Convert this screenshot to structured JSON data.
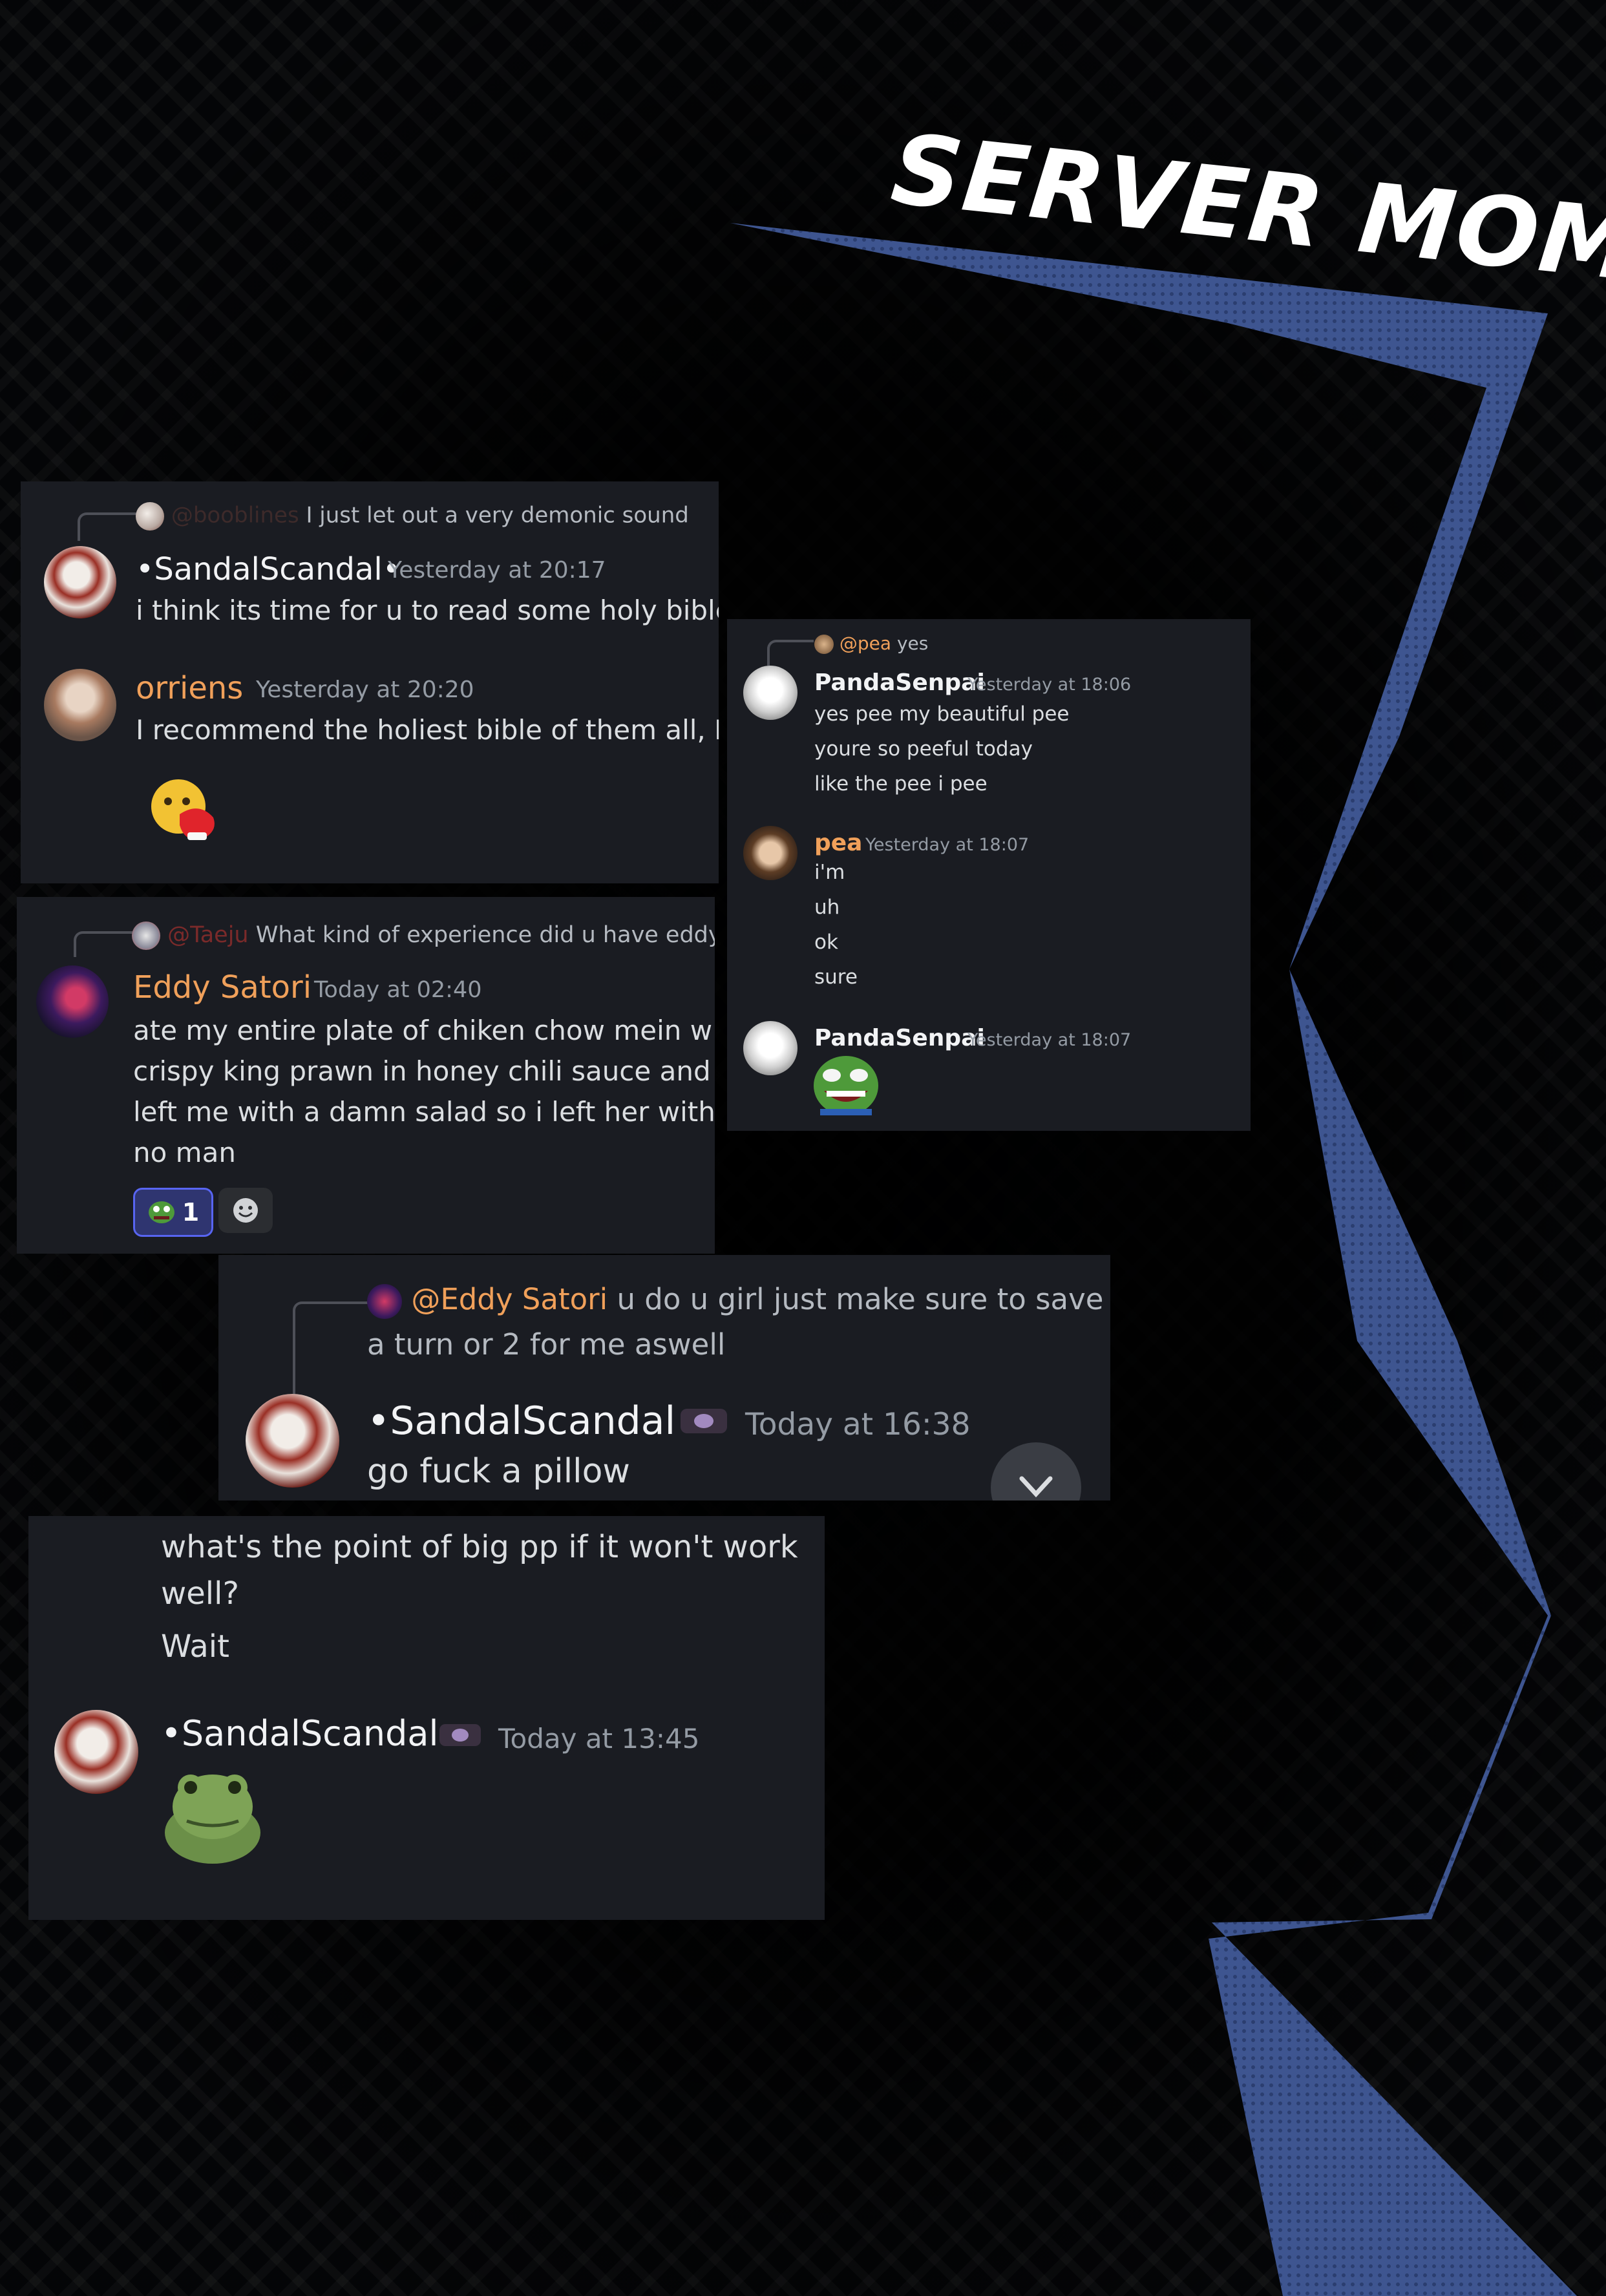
{
  "title": "SERVER MOMENTS",
  "colors": {
    "background": "#050608",
    "panel": "#1a1c22",
    "bolt": "#3e5590",
    "orange_name": "#f0a05a"
  },
  "panel1": {
    "reply": {
      "mention": "@booblines",
      "text": "I just let out a very demonic sound"
    },
    "msg1": {
      "username": "•SandalScandal•",
      "timestamp": "Yesterday at 20:17",
      "text": "i think its time for u to read some holy bible"
    },
    "msg2": {
      "username": "orriens",
      "timestamp": "Yesterday at 20:20",
      "text": "I recommend the holiest bible of them all, Bl."
    }
  },
  "panel2": {
    "reply": {
      "mention": "@pea",
      "text": "yes"
    },
    "msg1": {
      "username": "PandaSenpai",
      "timestamp": "Yesterday at 18:06",
      "lines": [
        "yes pee my beautiful pee",
        "youre so peeful today",
        "like the pee i pee"
      ]
    },
    "msg2": {
      "username": "pea",
      "timestamp": "Yesterday at 18:07",
      "lines": [
        "i'm",
        "uh",
        "ok",
        "sure"
      ]
    },
    "msg3": {
      "username": "PandaSenpai",
      "timestamp": "Yesterday at 18:07"
    }
  },
  "panel3": {
    "reply": {
      "mention": "@Taeju",
      "text": "What kind of experience did u have eddy"
    },
    "msg": {
      "username": "Eddy Satori",
      "timestamp": "Today at 02:40",
      "text": "ate my entire plate of chiken chow mein with crispy king prawn in honey chili sauce and left me with a damn salad so i left her with no man"
    },
    "reaction_count": "1"
  },
  "panel4": {
    "reply": {
      "mention": "@Eddy Satori",
      "text": "u do u girl just make sure to save a turn or 2 for me aswell"
    },
    "msg": {
      "username": "•SandalScandal•",
      "timestamp": "Today at 16:38",
      "text": "go fuck a pillow"
    }
  },
  "panel5": {
    "prev": {
      "line1": "what's the point of big pp if it won't work well?",
      "line2": "Wait"
    },
    "msg": {
      "username": "•SandalScandal•",
      "timestamp": "Today at 13:45"
    }
  }
}
